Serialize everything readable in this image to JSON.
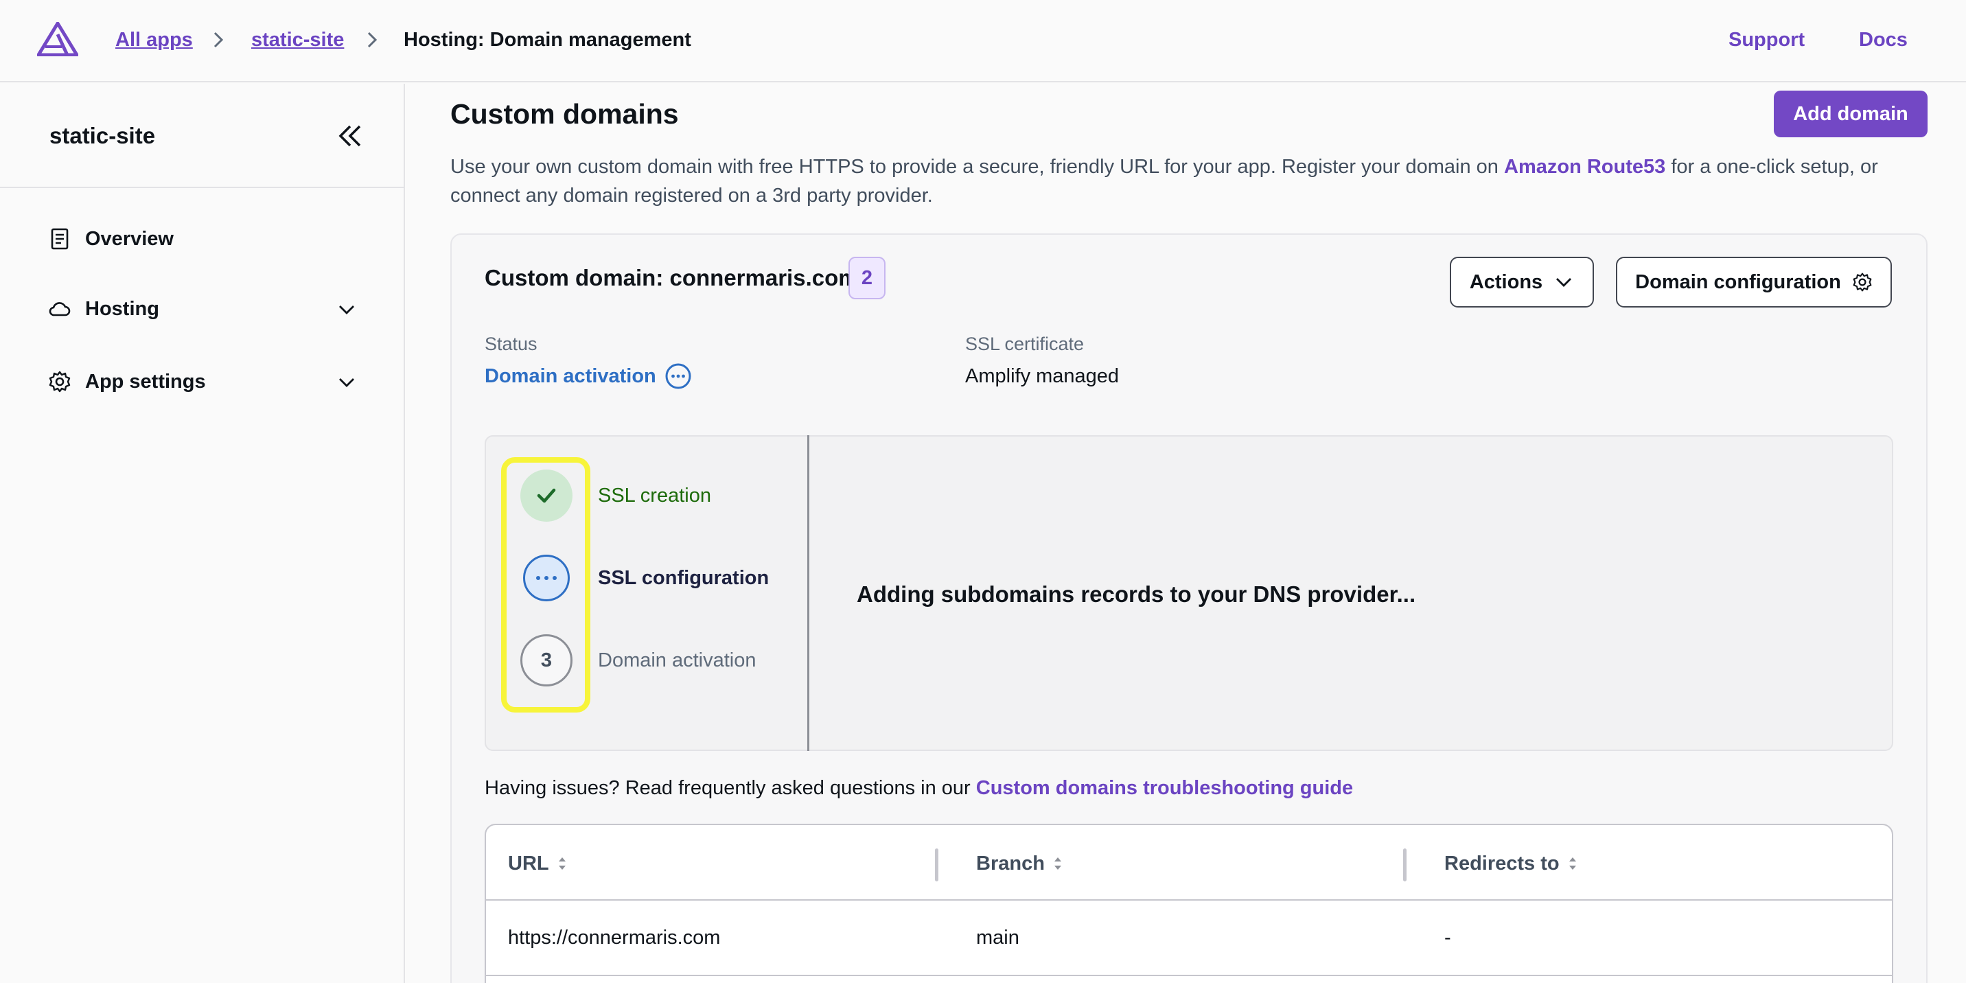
{
  "breadcrumb": {
    "all_apps": "All apps",
    "app": "static-site",
    "current": "Hosting: Domain management"
  },
  "toplinks": {
    "support": "Support",
    "docs": "Docs"
  },
  "sidebar": {
    "title": "static-site",
    "items": [
      {
        "label": "Overview",
        "icon": "document-icon"
      },
      {
        "label": "Hosting",
        "icon": "cloud-icon"
      },
      {
        "label": "App settings",
        "icon": "gear-icon"
      }
    ]
  },
  "main": {
    "title": "Custom domains",
    "add_button": "Add domain",
    "desc_1": "Use your own custom domain with free HTTPS to provide a secure, friendly URL for your app. Register your domain on ",
    "desc_link": "Amazon Route53",
    "desc_2": " for a one-click setup, or connect any domain registered on a 3rd party provider."
  },
  "domain_card": {
    "title": "Custom domain: connermaris.com",
    "count": "2",
    "actions_button": "Actions",
    "config_button": "Domain configuration",
    "status_label": "Status",
    "status_value": "Domain activation",
    "ssl_label": "SSL certificate",
    "ssl_value": "Amplify managed"
  },
  "progress": {
    "steps": [
      {
        "label": "SSL creation",
        "state": "complete"
      },
      {
        "label": "SSL configuration",
        "state": "in-progress"
      },
      {
        "label": "Domain activation",
        "state": "pending",
        "number": "3"
      }
    ],
    "message": "Adding subdomains records to your DNS provider..."
  },
  "issues": {
    "text": "Having issues? Read frequently asked questions in our ",
    "link": "Custom domains troubleshooting guide"
  },
  "table": {
    "headers": [
      "URL",
      "Branch",
      "Redirects to"
    ],
    "rows": [
      [
        "https://connermaris.com",
        "main",
        "-"
      ]
    ]
  },
  "colors": {
    "accent": "#7348c5",
    "link": "#6b44c2",
    "status_link": "#2e6fc4",
    "success": "#1d8102",
    "highlight": "#f7f43a"
  }
}
